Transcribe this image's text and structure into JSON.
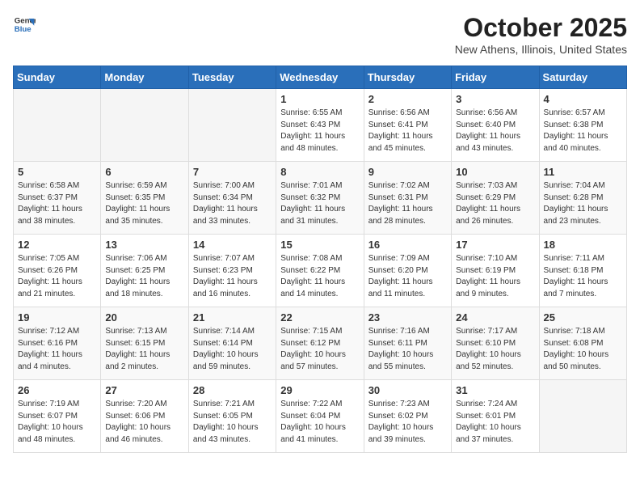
{
  "header": {
    "logo_line1": "General",
    "logo_line2": "Blue",
    "month_title": "October 2025",
    "location": "New Athens, Illinois, United States"
  },
  "weekdays": [
    "Sunday",
    "Monday",
    "Tuesday",
    "Wednesday",
    "Thursday",
    "Friday",
    "Saturday"
  ],
  "weeks": [
    [
      {
        "day": "",
        "info": ""
      },
      {
        "day": "",
        "info": ""
      },
      {
        "day": "",
        "info": ""
      },
      {
        "day": "1",
        "info": "Sunrise: 6:55 AM\nSunset: 6:43 PM\nDaylight: 11 hours\nand 48 minutes."
      },
      {
        "day": "2",
        "info": "Sunrise: 6:56 AM\nSunset: 6:41 PM\nDaylight: 11 hours\nand 45 minutes."
      },
      {
        "day": "3",
        "info": "Sunrise: 6:56 AM\nSunset: 6:40 PM\nDaylight: 11 hours\nand 43 minutes."
      },
      {
        "day": "4",
        "info": "Sunrise: 6:57 AM\nSunset: 6:38 PM\nDaylight: 11 hours\nand 40 minutes."
      }
    ],
    [
      {
        "day": "5",
        "info": "Sunrise: 6:58 AM\nSunset: 6:37 PM\nDaylight: 11 hours\nand 38 minutes."
      },
      {
        "day": "6",
        "info": "Sunrise: 6:59 AM\nSunset: 6:35 PM\nDaylight: 11 hours\nand 35 minutes."
      },
      {
        "day": "7",
        "info": "Sunrise: 7:00 AM\nSunset: 6:34 PM\nDaylight: 11 hours\nand 33 minutes."
      },
      {
        "day": "8",
        "info": "Sunrise: 7:01 AM\nSunset: 6:32 PM\nDaylight: 11 hours\nand 31 minutes."
      },
      {
        "day": "9",
        "info": "Sunrise: 7:02 AM\nSunset: 6:31 PM\nDaylight: 11 hours\nand 28 minutes."
      },
      {
        "day": "10",
        "info": "Sunrise: 7:03 AM\nSunset: 6:29 PM\nDaylight: 11 hours\nand 26 minutes."
      },
      {
        "day": "11",
        "info": "Sunrise: 7:04 AM\nSunset: 6:28 PM\nDaylight: 11 hours\nand 23 minutes."
      }
    ],
    [
      {
        "day": "12",
        "info": "Sunrise: 7:05 AM\nSunset: 6:26 PM\nDaylight: 11 hours\nand 21 minutes."
      },
      {
        "day": "13",
        "info": "Sunrise: 7:06 AM\nSunset: 6:25 PM\nDaylight: 11 hours\nand 18 minutes."
      },
      {
        "day": "14",
        "info": "Sunrise: 7:07 AM\nSunset: 6:23 PM\nDaylight: 11 hours\nand 16 minutes."
      },
      {
        "day": "15",
        "info": "Sunrise: 7:08 AM\nSunset: 6:22 PM\nDaylight: 11 hours\nand 14 minutes."
      },
      {
        "day": "16",
        "info": "Sunrise: 7:09 AM\nSunset: 6:20 PM\nDaylight: 11 hours\nand 11 minutes."
      },
      {
        "day": "17",
        "info": "Sunrise: 7:10 AM\nSunset: 6:19 PM\nDaylight: 11 hours\nand 9 minutes."
      },
      {
        "day": "18",
        "info": "Sunrise: 7:11 AM\nSunset: 6:18 PM\nDaylight: 11 hours\nand 7 minutes."
      }
    ],
    [
      {
        "day": "19",
        "info": "Sunrise: 7:12 AM\nSunset: 6:16 PM\nDaylight: 11 hours\nand 4 minutes."
      },
      {
        "day": "20",
        "info": "Sunrise: 7:13 AM\nSunset: 6:15 PM\nDaylight: 11 hours\nand 2 minutes."
      },
      {
        "day": "21",
        "info": "Sunrise: 7:14 AM\nSunset: 6:14 PM\nDaylight: 10 hours\nand 59 minutes."
      },
      {
        "day": "22",
        "info": "Sunrise: 7:15 AM\nSunset: 6:12 PM\nDaylight: 10 hours\nand 57 minutes."
      },
      {
        "day": "23",
        "info": "Sunrise: 7:16 AM\nSunset: 6:11 PM\nDaylight: 10 hours\nand 55 minutes."
      },
      {
        "day": "24",
        "info": "Sunrise: 7:17 AM\nSunset: 6:10 PM\nDaylight: 10 hours\nand 52 minutes."
      },
      {
        "day": "25",
        "info": "Sunrise: 7:18 AM\nSunset: 6:08 PM\nDaylight: 10 hours\nand 50 minutes."
      }
    ],
    [
      {
        "day": "26",
        "info": "Sunrise: 7:19 AM\nSunset: 6:07 PM\nDaylight: 10 hours\nand 48 minutes."
      },
      {
        "day": "27",
        "info": "Sunrise: 7:20 AM\nSunset: 6:06 PM\nDaylight: 10 hours\nand 46 minutes."
      },
      {
        "day": "28",
        "info": "Sunrise: 7:21 AM\nSunset: 6:05 PM\nDaylight: 10 hours\nand 43 minutes."
      },
      {
        "day": "29",
        "info": "Sunrise: 7:22 AM\nSunset: 6:04 PM\nDaylight: 10 hours\nand 41 minutes."
      },
      {
        "day": "30",
        "info": "Sunrise: 7:23 AM\nSunset: 6:02 PM\nDaylight: 10 hours\nand 39 minutes."
      },
      {
        "day": "31",
        "info": "Sunrise: 7:24 AM\nSunset: 6:01 PM\nDaylight: 10 hours\nand 37 minutes."
      },
      {
        "day": "",
        "info": ""
      }
    ]
  ]
}
